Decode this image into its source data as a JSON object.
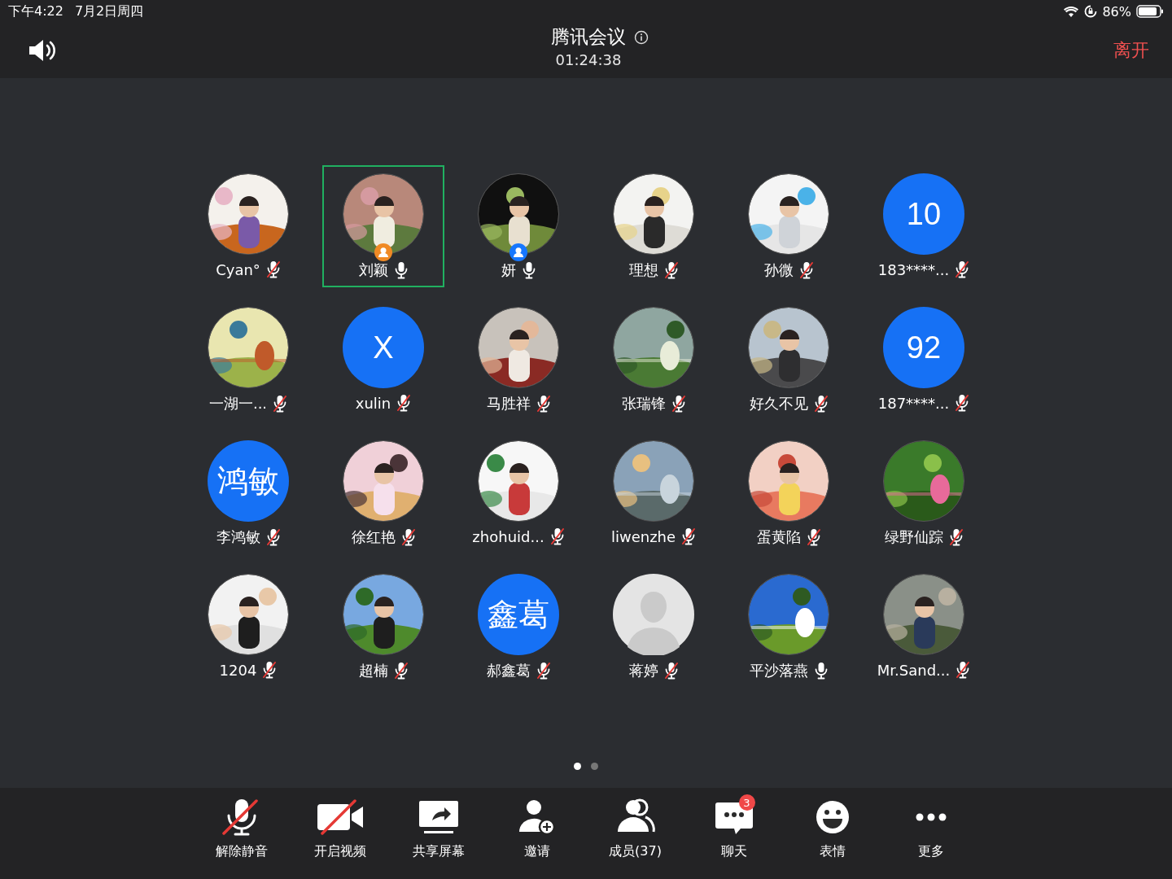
{
  "status_bar": {
    "time": "下午4:22",
    "date": "7月2日周四",
    "battery": "86%"
  },
  "header": {
    "title": "腾讯会议",
    "timer": "01:24:38",
    "leave": "离开"
  },
  "participants": [
    {
      "name": "Cyan°",
      "muted": true,
      "selected": false
    },
    {
      "name": "刘颖",
      "muted": false,
      "selected": true,
      "badge": {
        "color": "#f08a24"
      }
    },
    {
      "name": "妍",
      "muted": false,
      "selected": false,
      "badge": {
        "color": "#1677ff"
      }
    },
    {
      "name": "理想",
      "muted": true,
      "selected": false
    },
    {
      "name": "孙微",
      "muted": true,
      "selected": false
    },
    {
      "name": "183****...",
      "muted": true,
      "selected": false,
      "avatar": {
        "kind": "initials",
        "text": "10"
      }
    },
    {
      "name": "一湖一...",
      "muted": true,
      "selected": false
    },
    {
      "name": "xulin",
      "muted": true,
      "selected": false,
      "avatar": {
        "kind": "initials",
        "text": "X"
      }
    },
    {
      "name": "马胜祥",
      "muted": true,
      "selected": false
    },
    {
      "name": "张瑞锋",
      "muted": true,
      "selected": false
    },
    {
      "name": "好久不见",
      "muted": true,
      "selected": false
    },
    {
      "name": "187****...",
      "muted": true,
      "selected": false,
      "avatar": {
        "kind": "initials",
        "text": "92"
      }
    },
    {
      "name": "李鸿敏",
      "muted": true,
      "selected": false,
      "avatar": {
        "kind": "initials",
        "text": "鸿敏"
      }
    },
    {
      "name": "徐红艳",
      "muted": true,
      "selected": false
    },
    {
      "name": "zhohuid...",
      "muted": true,
      "selected": false
    },
    {
      "name": "liwenzhe",
      "muted": true,
      "selected": false
    },
    {
      "name": "蛋黄陷",
      "muted": true,
      "selected": false
    },
    {
      "name": "绿野仙踪",
      "muted": true,
      "selected": false
    },
    {
      "name": "1204",
      "muted": true,
      "selected": false
    },
    {
      "name": "超楠",
      "muted": true,
      "selected": false
    },
    {
      "name": "郝鑫葛",
      "muted": true,
      "selected": false,
      "avatar": {
        "kind": "initials",
        "text": "鑫葛"
      }
    },
    {
      "name": "蒋婷",
      "muted": true,
      "selected": false,
      "avatar": {
        "kind": "placeholder"
      }
    },
    {
      "name": "平沙落燕",
      "muted": false,
      "selected": false
    },
    {
      "name": "Mr.Sand...",
      "muted": true,
      "selected": false
    }
  ],
  "pages": [
    {
      "selected": true
    },
    {
      "selected": false
    }
  ],
  "toolbar": [
    {
      "kind": "mic",
      "label": "解除静音",
      "off": true
    },
    {
      "kind": "video",
      "label": "开启视频",
      "off": true
    },
    {
      "kind": "share",
      "label": "共享屏幕",
      "off": false
    },
    {
      "kind": "invite",
      "label": "邀请",
      "off": false
    },
    {
      "kind": "members",
      "label": "成员(37)",
      "off": false
    },
    {
      "kind": "chat",
      "label": "聊天",
      "off": false,
      "badge": "3"
    },
    {
      "kind": "emoji",
      "label": "表情",
      "off": false
    },
    {
      "kind": "more",
      "label": "更多",
      "off": false
    }
  ]
}
